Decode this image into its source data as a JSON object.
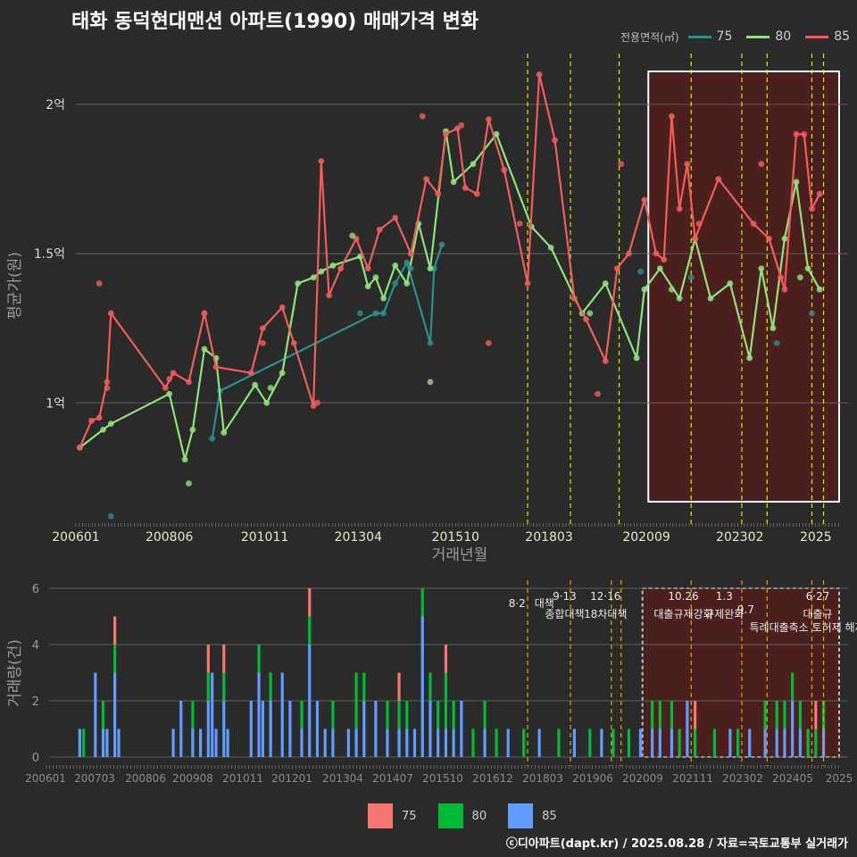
{
  "title": "태화 동덕현대맨션 아파트(1990) 매매가격 변화",
  "footer": "ⓒ디아파트(dapt.kr) / 2025.08.28 / 자료=국토교통부 실거래가",
  "legend_title": "전용면적(㎡)",
  "colors": {
    "s75": "#2a8f8f",
    "s80": "#8fe37a",
    "s85": "#f25c5c",
    "bar75": "#f87672",
    "bar80": "#00ba38",
    "bar85": "#619cff",
    "vline": "#e6e600",
    "vline2": "#e6a400",
    "hilite": "#5a1e1e"
  },
  "chart_data": [
    {
      "type": "line",
      "title": "태화 동덕현대맨션 아파트(1990) 매매가격 변화",
      "xlabel": "거래년월",
      "ylabel": "평균가(원)",
      "x_ticks": [
        "200601",
        "200806",
        "201011",
        "201304",
        "201510",
        "201803",
        "202009",
        "202302",
        "2025"
      ],
      "y_ticks": [
        "1억",
        "1.5억",
        "2억"
      ],
      "ylim": [
        0.6,
        2.2
      ],
      "legend_title": "전용면적(㎡)",
      "series": [
        {
          "name": "75",
          "points": [
            [
              2009.5,
              0.88
            ],
            [
              2009.7,
              1.04
            ],
            [
              2013.7,
              1.3
            ],
            [
              2013.9,
              1.3
            ],
            [
              2014.2,
              1.4
            ],
            [
              2014.5,
              1.47
            ],
            [
              2015.1,
              1.2
            ],
            [
              2015.2,
              1.45
            ],
            [
              2015.4,
              1.53
            ]
          ]
        },
        {
          "name": "80",
          "points": [
            [
              2006.1,
              0.85
            ],
            [
              2006.7,
              0.91
            ],
            [
              2006.9,
              0.93
            ],
            [
              2008.4,
              1.03
            ],
            [
              2008.8,
              0.81
            ],
            [
              2009.0,
              0.91
            ],
            [
              2009.3,
              1.18
            ],
            [
              2009.6,
              1.15
            ],
            [
              2009.8,
              0.9
            ],
            [
              2010.6,
              1.06
            ],
            [
              2010.9,
              1.0
            ],
            [
              2011.3,
              1.1
            ],
            [
              2011.7,
              1.4
            ],
            [
              2012.1,
              1.42
            ],
            [
              2012.3,
              1.44
            ],
            [
              2012.6,
              1.46
            ],
            [
              2013.3,
              1.49
            ],
            [
              2013.5,
              1.39
            ],
            [
              2013.7,
              1.42
            ],
            [
              2013.9,
              1.35
            ],
            [
              2014.2,
              1.46
            ],
            [
              2014.5,
              1.4
            ],
            [
              2014.8,
              1.6
            ],
            [
              2015.1,
              1.45
            ],
            [
              2015.5,
              1.91
            ],
            [
              2015.7,
              1.74
            ],
            [
              2016.2,
              1.8
            ],
            [
              2016.8,
              1.9
            ],
            [
              2017.7,
              1.59
            ],
            [
              2018.2,
              1.52
            ],
            [
              2019.0,
              1.3
            ],
            [
              2019.6,
              1.4
            ],
            [
              2020.4,
              1.15
            ],
            [
              2020.6,
              1.38
            ],
            [
              2021.0,
              1.45
            ],
            [
              2021.5,
              1.35
            ],
            [
              2021.9,
              1.55
            ],
            [
              2022.3,
              1.35
            ],
            [
              2022.8,
              1.4
            ],
            [
              2023.3,
              1.15
            ],
            [
              2023.6,
              1.45
            ],
            [
              2023.9,
              1.25
            ],
            [
              2024.2,
              1.55
            ],
            [
              2024.5,
              1.74
            ],
            [
              2024.8,
              1.45
            ],
            [
              2025.1,
              1.38
            ]
          ]
        },
        {
          "name": "85",
          "points": [
            [
              2006.1,
              0.85
            ],
            [
              2006.4,
              0.94
            ],
            [
              2006.6,
              0.95
            ],
            [
              2006.8,
              1.07
            ],
            [
              2006.9,
              1.3
            ],
            [
              2008.3,
              1.05
            ],
            [
              2008.5,
              1.1
            ],
            [
              2008.9,
              1.07
            ],
            [
              2009.3,
              1.3
            ],
            [
              2009.6,
              1.12
            ],
            [
              2010.5,
              1.1
            ],
            [
              2010.8,
              1.25
            ],
            [
              2011.3,
              1.32
            ],
            [
              2011.6,
              1.2
            ],
            [
              2012.1,
              0.99
            ],
            [
              2012.3,
              1.81
            ],
            [
              2012.5,
              1.36
            ],
            [
              2012.8,
              1.45
            ],
            [
              2013.2,
              1.55
            ],
            [
              2013.5,
              1.45
            ],
            [
              2013.8,
              1.58
            ],
            [
              2014.2,
              1.62
            ],
            [
              2014.6,
              1.5
            ],
            [
              2015.0,
              1.75
            ],
            [
              2015.3,
              1.7
            ],
            [
              2015.5,
              1.9
            ],
            [
              2015.8,
              1.92
            ],
            [
              2016.0,
              1.72
            ],
            [
              2016.3,
              1.7
            ],
            [
              2016.6,
              1.95
            ],
            [
              2017.0,
              1.78
            ],
            [
              2017.6,
              1.4
            ],
            [
              2017.9,
              2.1
            ],
            [
              2018.3,
              1.88
            ],
            [
              2018.8,
              1.35
            ],
            [
              2019.1,
              1.28
            ],
            [
              2019.6,
              1.14
            ],
            [
              2019.9,
              1.45
            ],
            [
              2020.2,
              1.5
            ],
            [
              2020.6,
              1.68
            ],
            [
              2020.9,
              1.5
            ],
            [
              2021.1,
              1.48
            ],
            [
              2021.3,
              1.96
            ],
            [
              2021.5,
              1.65
            ],
            [
              2021.7,
              1.8
            ],
            [
              2021.9,
              1.55
            ],
            [
              2022.5,
              1.75
            ],
            [
              2023.4,
              1.6
            ],
            [
              2023.8,
              1.55
            ],
            [
              2024.2,
              1.38
            ],
            [
              2024.5,
              1.9
            ],
            [
              2024.7,
              1.9
            ],
            [
              2024.9,
              1.65
            ],
            [
              2025.1,
              1.7
            ]
          ]
        }
      ],
      "scatter_extra": [
        {
          "series": "75",
          "points": [
            [
              2006.9,
              0.62
            ],
            [
              2013.3,
              1.3
            ],
            [
              2014.6,
              1.45
            ],
            [
              2020.5,
              1.44
            ],
            [
              2021.8,
              1.42
            ],
            [
              2024.0,
              1.2
            ],
            [
              2024.9,
              1.3
            ]
          ]
        },
        {
          "series": "80",
          "points": [
            [
              2008.9,
              0.73
            ],
            [
              2015.1,
              1.07
            ],
            [
              2013.1,
              1.56
            ],
            [
              2011.0,
              1.05
            ],
            [
              2019.2,
              1.3
            ],
            [
              2021.3,
              1.38
            ],
            [
              2024.6,
              1.42
            ]
          ]
        },
        {
          "series": "85",
          "points": [
            [
              2006.6,
              1.4
            ],
            [
              2006.8,
              1.05
            ],
            [
              2008.4,
              1.08
            ],
            [
              2009.3,
              1.3
            ],
            [
              2010.8,
              1.2
            ],
            [
              2012.2,
              1.0
            ],
            [
              2014.9,
              1.96
            ],
            [
              2015.9,
              1.93
            ],
            [
              2016.6,
              1.2
            ],
            [
              2017.4,
              1.6
            ],
            [
              2019.4,
              1.03
            ],
            [
              2020.0,
              1.8
            ],
            [
              2022.0,
              1.6
            ],
            [
              2023.6,
              1.8
            ],
            [
              2024.1,
              1.42
            ]
          ]
        }
      ],
      "policy_lines_x": [
        2017.6,
        2018.7,
        2019.95,
        2021.8,
        2023.1,
        2023.75,
        2024.9,
        2025.2
      ]
    },
    {
      "type": "bar",
      "xlabel": "",
      "ylabel": "거래량(건)",
      "x_ticks": [
        "200601",
        "200703",
        "200806",
        "200908",
        "201011",
        "201201",
        "201304",
        "201407",
        "201510",
        "201612",
        "201803",
        "201906",
        "202009",
        "202111",
        "202302",
        "202405",
        "2025"
      ],
      "y_ticks": [
        "0",
        "2",
        "4",
        "6"
      ],
      "ylim": [
        0,
        6.4
      ],
      "legend": [
        "75",
        "80",
        "85"
      ],
      "annotations": [
        {
          "date": "8·2",
          "label": "대책"
        },
        {
          "date": "9·13",
          "label": "종합대책"
        },
        {
          "date": "12·16",
          "label": "18차대책"
        },
        {
          "date": "10.26",
          "label": "대출규제강화"
        },
        {
          "date": "1.3",
          "label": "규제완화"
        },
        {
          "date": "9.7",
          "label": "특례대출축소 토허제 해제"
        },
        {
          "date": "6·27",
          "label": "대출규"
        }
      ],
      "stacks": [
        [
          2006.1,
          0,
          0,
          1
        ],
        [
          2006.2,
          0,
          1,
          0
        ],
        [
          2006.5,
          0,
          0,
          3
        ],
        [
          2006.7,
          0,
          1,
          1
        ],
        [
          2006.8,
          0,
          0,
          1
        ],
        [
          2007.0,
          1,
          1,
          3
        ],
        [
          2007.1,
          0,
          0,
          1
        ],
        [
          2008.5,
          0,
          0,
          1
        ],
        [
          2008.7,
          0,
          0,
          2
        ],
        [
          2009.0,
          0,
          1,
          1
        ],
        [
          2009.2,
          0,
          0,
          1
        ],
        [
          2009.4,
          1,
          1,
          2
        ],
        [
          2009.5,
          0,
          0,
          3
        ],
        [
          2009.6,
          0,
          0,
          1
        ],
        [
          2009.8,
          1,
          1,
          2
        ],
        [
          2009.9,
          0,
          0,
          1
        ],
        [
          2010.5,
          0,
          0,
          2
        ],
        [
          2010.7,
          0,
          1,
          3
        ],
        [
          2010.8,
          0,
          0,
          2
        ],
        [
          2011.0,
          0,
          1,
          2
        ],
        [
          2011.3,
          0,
          0,
          3
        ],
        [
          2011.5,
          0,
          0,
          2
        ],
        [
          2011.8,
          0,
          1,
          1
        ],
        [
          2012.0,
          1,
          1,
          4
        ],
        [
          2012.2,
          0,
          0,
          2
        ],
        [
          2012.4,
          0,
          0,
          1
        ],
        [
          2012.6,
          0,
          1,
          1
        ],
        [
          2013.0,
          0,
          0,
          1
        ],
        [
          2013.2,
          0,
          2,
          1
        ],
        [
          2013.4,
          0,
          1,
          2
        ],
        [
          2013.7,
          0,
          0,
          2
        ],
        [
          2014.0,
          0,
          1,
          1
        ],
        [
          2014.3,
          1,
          1,
          1
        ],
        [
          2014.5,
          0,
          1,
          1
        ],
        [
          2014.7,
          0,
          0,
          1
        ],
        [
          2014.9,
          0,
          1,
          5
        ],
        [
          2015.1,
          0,
          1,
          2
        ],
        [
          2015.3,
          0,
          1,
          1
        ],
        [
          2015.5,
          1,
          2,
          1
        ],
        [
          2015.7,
          0,
          1,
          1
        ],
        [
          2015.9,
          0,
          0,
          2
        ],
        [
          2016.2,
          0,
          1,
          0
        ],
        [
          2016.5,
          0,
          1,
          1
        ],
        [
          2016.8,
          0,
          1,
          0
        ],
        [
          2017.1,
          0,
          0,
          1
        ],
        [
          2017.5,
          0,
          1,
          0
        ],
        [
          2017.9,
          0,
          0,
          1
        ],
        [
          2018.4,
          0,
          1,
          0
        ],
        [
          2018.8,
          0,
          0,
          1
        ],
        [
          2019.2,
          0,
          1,
          0
        ],
        [
          2019.5,
          0,
          0,
          1
        ],
        [
          2019.8,
          0,
          1,
          0
        ],
        [
          2020.2,
          0,
          1,
          0
        ],
        [
          2020.5,
          0,
          0,
          1
        ],
        [
          2020.8,
          0,
          1,
          1
        ],
        [
          2021.0,
          0,
          1,
          1
        ],
        [
          2021.3,
          0,
          1,
          1
        ],
        [
          2021.5,
          0,
          1,
          0
        ],
        [
          2021.7,
          0,
          0,
          2
        ],
        [
          2021.9,
          1,
          1,
          0
        ],
        [
          2022.4,
          0,
          1,
          0
        ],
        [
          2022.8,
          0,
          0,
          1
        ],
        [
          2023.0,
          0,
          1,
          0
        ],
        [
          2023.3,
          0,
          0,
          1
        ],
        [
          2023.7,
          0,
          1,
          1
        ],
        [
          2024.0,
          0,
          1,
          1
        ],
        [
          2024.2,
          0,
          1,
          1
        ],
        [
          2024.4,
          0,
          1,
          2
        ],
        [
          2024.6,
          0,
          1,
          1
        ],
        [
          2024.8,
          0,
          1,
          0
        ],
        [
          2025.0,
          1,
          1,
          0
        ],
        [
          2025.2,
          0,
          1,
          1
        ]
      ]
    }
  ]
}
